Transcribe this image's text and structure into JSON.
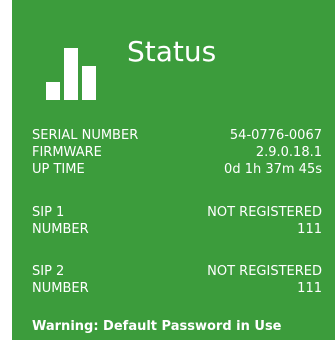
{
  "tile": {
    "title": "Status",
    "icon": "bar-chart-icon",
    "background_color": "#3c9c3c",
    "text_color": "#ffffff"
  },
  "info": {
    "serial_number_label": "SERIAL NUMBER",
    "serial_number_value": "54-0776-0067",
    "firmware_label": "FIRMWARE",
    "firmware_value": "2.9.0.18.1",
    "uptime_label": "UP TIME",
    "uptime_value": "0d 1h 37m 45s"
  },
  "sip1": {
    "label": "SIP 1",
    "status": "NOT REGISTERED",
    "number_label": "NUMBER",
    "number_value": "111"
  },
  "sip2": {
    "label": "SIP 2",
    "status": "NOT REGISTERED",
    "number_label": "NUMBER",
    "number_value": "111"
  },
  "warning": "Warning: Default Password in Use"
}
